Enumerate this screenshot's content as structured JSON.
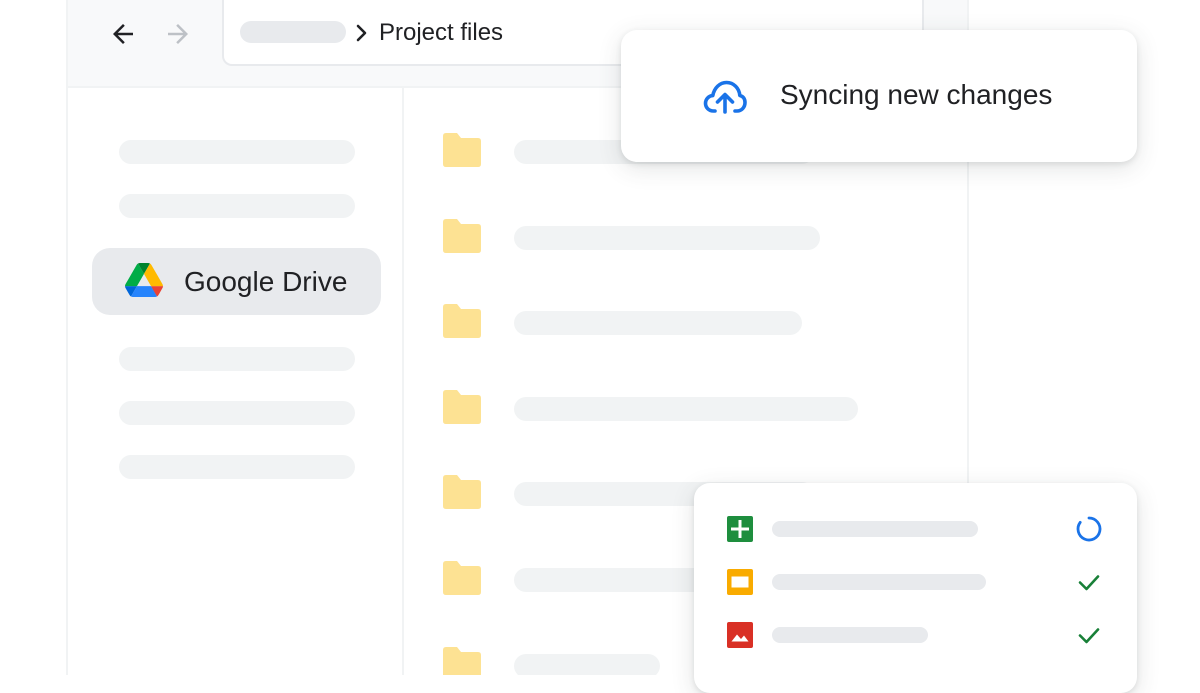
{
  "toolbar": {
    "back_icon": "arrow-left-icon",
    "forward_icon": "arrow-right-icon",
    "breadcrumb_separator_icon": "chevron-right-icon",
    "breadcrumb_current": "Project files"
  },
  "sidebar": {
    "active_item": {
      "icon": "google-drive-icon",
      "label": "Google Drive"
    }
  },
  "files": {
    "item_icon": "folder-icon",
    "folder_color": "#fde293"
  },
  "sync_notification": {
    "icon": "cloud-upload-icon",
    "text": "Syncing new changes"
  },
  "upload_status": {
    "items": [
      {
        "type_icon": "google-sheets-icon",
        "status_icon": "spinner-icon",
        "status": "syncing"
      },
      {
        "type_icon": "google-slides-icon",
        "status_icon": "checkmark-icon",
        "status": "done"
      },
      {
        "type_icon": "image-file-icon",
        "status_icon": "checkmark-icon",
        "status": "done"
      }
    ]
  },
  "colors": {
    "accent_blue": "#1a73e8",
    "success_green": "#188038",
    "sheets_green": "#1e8e3e",
    "slides_yellow": "#f9ab00",
    "image_red": "#d93025",
    "placeholder_gray": "#f1f3f4"
  }
}
